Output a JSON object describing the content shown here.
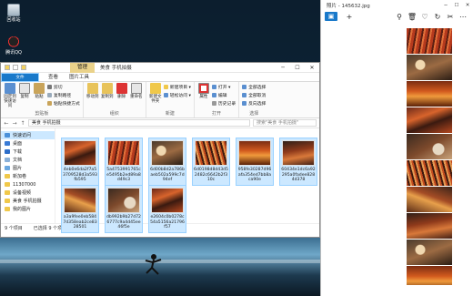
{
  "desktop": {
    "icons": [
      {
        "label": "回收站"
      },
      {
        "label": "腾讯QQ"
      }
    ]
  },
  "explorer": {
    "title": "美食 手机拍摄",
    "manage_tab": "管理",
    "window_controls": {
      "minimize": "─",
      "maximize": "☐",
      "close": "✕"
    },
    "ribbon_tabs": [
      "文件",
      "主页",
      "共享",
      "查看",
      "图片工具"
    ],
    "ribbon": {
      "clipboard": {
        "label": "剪贴板",
        "pin": "固定到快速访问",
        "copy": "复制",
        "paste": "粘贴",
        "cut": "剪切",
        "copy_path": "复制路径",
        "paste_shortcut": "粘贴快捷方式"
      },
      "organize": {
        "label": "组织",
        "move_to": "移动到",
        "copy_to": "复制到",
        "delete": "删除",
        "rename": "重命名"
      },
      "new": {
        "label": "新建",
        "new_folder": "新建文件夹",
        "new_item": "新建项目 ▾",
        "easy_access": "轻松访问 ▾"
      },
      "open": {
        "label": "打开",
        "properties": "属性",
        "open": "打开 ▾",
        "edit": "编辑",
        "history": "历史记录"
      },
      "select": {
        "label": "选择",
        "select_all": "全部选择",
        "select_none": "全部取消",
        "invert": "反向选择"
      }
    },
    "address": {
      "back": "←",
      "forward": "→",
      "up": "↑",
      "path": "美食 手机拍摄",
      "search_placeholder": "搜索\"美食 手机拍摄\""
    },
    "nav_pane": [
      {
        "label": "快速访问",
        "active": true
      },
      {
        "label": "桌面"
      },
      {
        "label": "下载"
      },
      {
        "label": "文档"
      },
      {
        "label": "图片"
      },
      {
        "label": "新加卷"
      },
      {
        "label": "11307000"
      },
      {
        "label": "设备视频"
      },
      {
        "label": "美食 手机拍摄"
      },
      {
        "label": "我的图片"
      }
    ],
    "files": [
      {
        "name": "4eb0e6da2f7a53709528d3a593fb595"
      },
      {
        "name": "5a4753991765ce5495b2ed89a8d49c3"
      },
      {
        "name": "6d00b8d2a786baeb502a599c7d94ef"
      },
      {
        "name": "6d0198d8d43d52482c6642b2f310c"
      },
      {
        "name": "958fe30287d96afa354ed7bb8aca90e"
      },
      {
        "name": "60434e1dc6a92295a0fadee8284d378"
      },
      {
        "name": "a3a9fee0eb5847d358eab2ce8328501"
      },
      {
        "name": "db992b9b27d726777c9a4d45ee46f5e"
      },
      {
        "name": "e2604c0b0278c54a5156a21796f57"
      }
    ],
    "status": {
      "count": "9 个项目",
      "selected": "已选择 9 个项目  53.9 MB"
    }
  },
  "photos": {
    "title": "照片 - 145632.jpg",
    "controls": {
      "minimize": "─",
      "maximize": "☐",
      "close": "✕"
    },
    "toolbar": {
      "collection": "▣",
      "add": "+",
      "zoom": "⚲",
      "delete": "🗑",
      "favorite": "♡",
      "rotate": "↻",
      "crop": "✂",
      "more": "⋯"
    }
  },
  "colors": {
    "accent": "#1979ca",
    "selection": "#cce8ff",
    "manage_tab": "#ead28a"
  }
}
